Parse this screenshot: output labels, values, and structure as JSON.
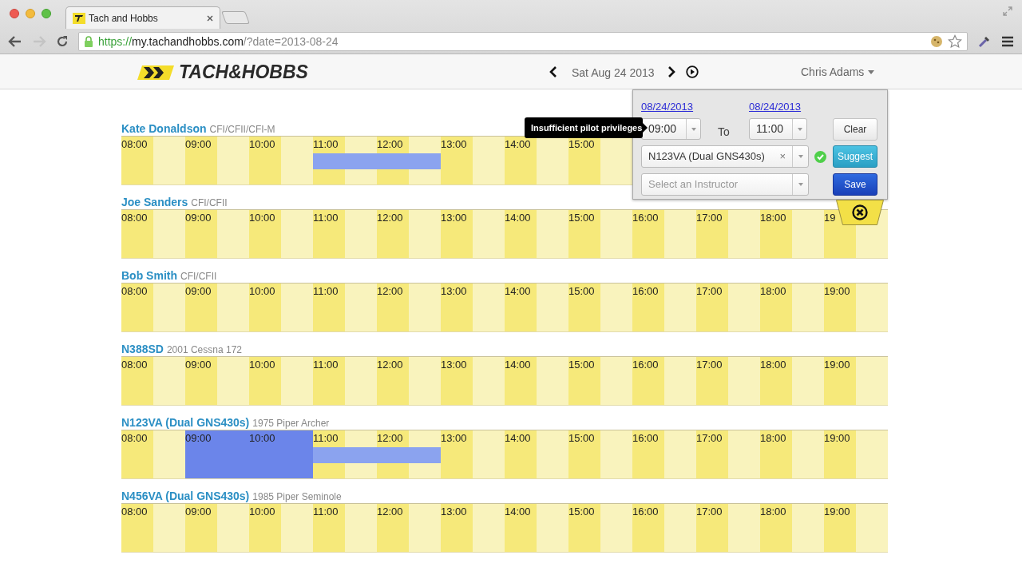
{
  "browser": {
    "tab_title": "Tach and Hobbs",
    "url": {
      "scheme": "https://",
      "host": "my.tachandhobbs.com",
      "path": "/?date=2013-08-24"
    },
    "back_enabled": true,
    "forward_enabled": false
  },
  "header": {
    "logo_text": "TACH&HOBBS",
    "date": "Sat Aug 24 2013",
    "user": "Chris Adams"
  },
  "rows": [
    {
      "name": "Kate Donaldson",
      "detail": "CFI/CFII/CFI-M",
      "hours": [
        {
          "label": "08:00",
          "selected": false,
          "reserved": false
        },
        {
          "label": "09:00",
          "selected": false,
          "reserved": false
        },
        {
          "label": "10:00",
          "selected": false,
          "reserved": false
        },
        {
          "label": "11:00",
          "selected": true,
          "reserved": false
        },
        {
          "label": "12:00",
          "selected": true,
          "reserved": false
        },
        {
          "label": "13:00",
          "selected": false,
          "reserved": false
        },
        {
          "label": "14:00",
          "selected": false,
          "reserved": false
        },
        {
          "label": "15:00",
          "selected": false,
          "reserved": false
        }
      ]
    },
    {
      "name": "Joe Sanders",
      "detail": "CFI/CFII",
      "hours": [
        {
          "label": "08:00",
          "selected": false,
          "reserved": false
        },
        {
          "label": "09:00",
          "selected": false,
          "reserved": false
        },
        {
          "label": "10:00",
          "selected": false,
          "reserved": false
        },
        {
          "label": "11:00",
          "selected": false,
          "reserved": false
        },
        {
          "label": "12:00",
          "selected": false,
          "reserved": false
        },
        {
          "label": "13:00",
          "selected": false,
          "reserved": false
        },
        {
          "label": "14:00",
          "selected": false,
          "reserved": false
        },
        {
          "label": "15:00",
          "selected": false,
          "reserved": false
        },
        {
          "label": "16:00",
          "selected": false,
          "reserved": false
        },
        {
          "label": "17:00",
          "selected": false,
          "reserved": false
        },
        {
          "label": "18:00",
          "selected": false,
          "reserved": false
        },
        {
          "label": "19",
          "selected": false,
          "reserved": false
        }
      ]
    },
    {
      "name": "Bob Smith",
      "detail": "CFI/CFII",
      "hours": [
        {
          "label": "08:00",
          "selected": false,
          "reserved": false
        },
        {
          "label": "09:00",
          "selected": false,
          "reserved": false
        },
        {
          "label": "10:00",
          "selected": false,
          "reserved": false
        },
        {
          "label": "11:00",
          "selected": false,
          "reserved": false
        },
        {
          "label": "12:00",
          "selected": false,
          "reserved": false
        },
        {
          "label": "13:00",
          "selected": false,
          "reserved": false
        },
        {
          "label": "14:00",
          "selected": false,
          "reserved": false
        },
        {
          "label": "15:00",
          "selected": false,
          "reserved": false
        },
        {
          "label": "16:00",
          "selected": false,
          "reserved": false
        },
        {
          "label": "17:00",
          "selected": false,
          "reserved": false
        },
        {
          "label": "18:00",
          "selected": false,
          "reserved": false
        },
        {
          "label": "19:00",
          "selected": false,
          "reserved": false
        }
      ]
    },
    {
      "name": "N388SD",
      "detail": "2001 Cessna 172",
      "hours": [
        {
          "label": "08:00",
          "selected": false,
          "reserved": false
        },
        {
          "label": "09:00",
          "selected": false,
          "reserved": false
        },
        {
          "label": "10:00",
          "selected": false,
          "reserved": false
        },
        {
          "label": "11:00",
          "selected": false,
          "reserved": false
        },
        {
          "label": "12:00",
          "selected": false,
          "reserved": false
        },
        {
          "label": "13:00",
          "selected": false,
          "reserved": false
        },
        {
          "label": "14:00",
          "selected": false,
          "reserved": false
        },
        {
          "label": "15:00",
          "selected": false,
          "reserved": false
        },
        {
          "label": "16:00",
          "selected": false,
          "reserved": false
        },
        {
          "label": "17:00",
          "selected": false,
          "reserved": false
        },
        {
          "label": "18:00",
          "selected": false,
          "reserved": false
        },
        {
          "label": "19:00",
          "selected": false,
          "reserved": false
        }
      ]
    },
    {
      "name": "N123VA (Dual GNS430s)",
      "detail": "1975 Piper Archer",
      "hours": [
        {
          "label": "08:00",
          "selected": false,
          "reserved": false
        },
        {
          "label": "09:00",
          "selected": false,
          "reserved": true
        },
        {
          "label": "10:00",
          "selected": false,
          "reserved": true
        },
        {
          "label": "11:00",
          "selected": true,
          "reserved": false
        },
        {
          "label": "12:00",
          "selected": true,
          "reserved": false
        },
        {
          "label": "13:00",
          "selected": false,
          "reserved": false
        },
        {
          "label": "14:00",
          "selected": false,
          "reserved": false
        },
        {
          "label": "15:00",
          "selected": false,
          "reserved": false
        },
        {
          "label": "16:00",
          "selected": false,
          "reserved": false
        },
        {
          "label": "17:00",
          "selected": false,
          "reserved": false
        },
        {
          "label": "18:00",
          "selected": false,
          "reserved": false
        },
        {
          "label": "19:00",
          "selected": false,
          "reserved": false
        }
      ]
    },
    {
      "name": "N456VA (Dual GNS430s)",
      "detail": "1985 Piper Seminole",
      "hours": [
        {
          "label": "08:00",
          "selected": false,
          "reserved": false
        },
        {
          "label": "09:00",
          "selected": false,
          "reserved": false
        },
        {
          "label": "10:00",
          "selected": false,
          "reserved": false
        },
        {
          "label": "11:00",
          "selected": false,
          "reserved": false
        },
        {
          "label": "12:00",
          "selected": false,
          "reserved": false
        },
        {
          "label": "13:00",
          "selected": false,
          "reserved": false
        },
        {
          "label": "14:00",
          "selected": false,
          "reserved": false
        },
        {
          "label": "15:00",
          "selected": false,
          "reserved": false
        },
        {
          "label": "16:00",
          "selected": false,
          "reserved": false
        },
        {
          "label": "17:00",
          "selected": false,
          "reserved": false
        },
        {
          "label": "18:00",
          "selected": false,
          "reserved": false
        },
        {
          "label": "19:00",
          "selected": false,
          "reserved": false
        }
      ]
    }
  ],
  "popup": {
    "start_date": "08/24/2013",
    "end_date": "08/24/2013",
    "start_time": "09:00",
    "to_label": "To",
    "end_time": "11:00",
    "clear": "Clear",
    "aircraft": "N123VA (Dual GNS430s)",
    "aircraft_clear": "×",
    "aircraft_valid": true,
    "suggest": "Suggest",
    "instructor_placeholder": "Select an Instructor",
    "save": "Save"
  },
  "tooltip": "Insufficient pilot privileges"
}
